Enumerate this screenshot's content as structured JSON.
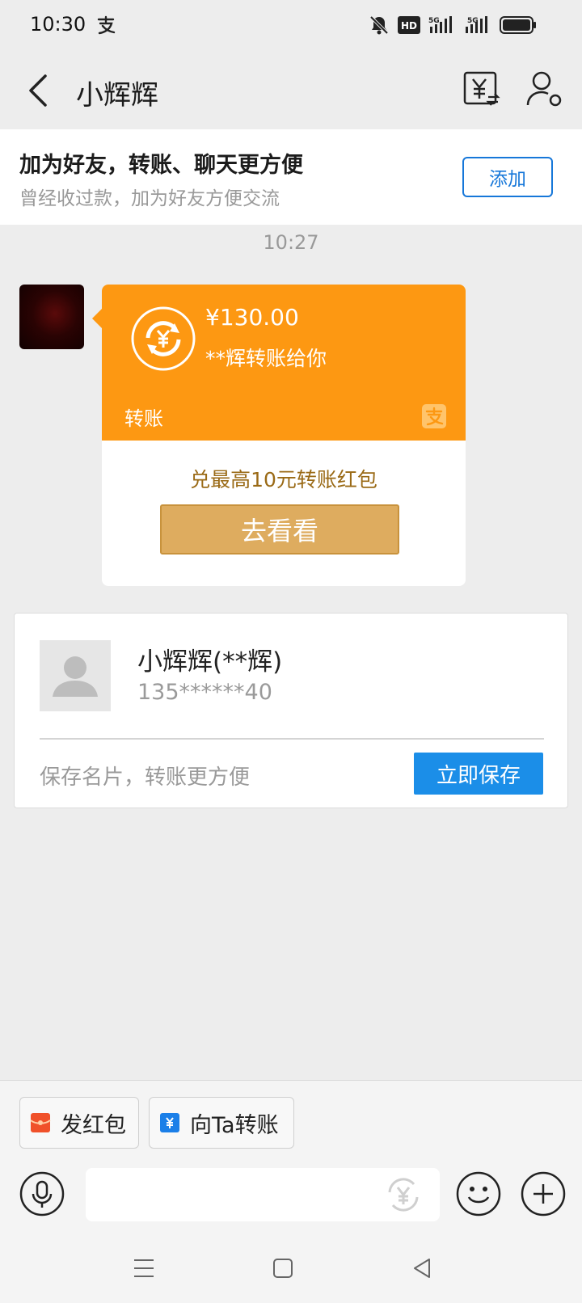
{
  "status_bar": {
    "time": "10:30",
    "icons": [
      "alipay-icon",
      "mute-icon",
      "hd-icon",
      "5g-signal-icon",
      "5g-signal-icon",
      "battery-icon"
    ],
    "hd_label": "HD",
    "network1": "5G",
    "network2": "5G"
  },
  "nav": {
    "title": "小辉辉"
  },
  "friend_banner": {
    "heading": "加为好友，转账、聊天更方便",
    "subtext": "曾经收过款，加为好友方便交流",
    "add_label": "添加"
  },
  "chat": {
    "timestamp": "10:27",
    "transfer_message": {
      "amount": "¥130.00",
      "description": "**辉转账给你",
      "type_label": "转账",
      "promo_text": "兑最高10元转账红包",
      "button_label": "去看看"
    }
  },
  "contact_card": {
    "name": "小辉辉(**辉)",
    "phone": "135******40",
    "hint": "保存名片，转账更方便",
    "save_label": "立即保存"
  },
  "quick_actions": {
    "red_packet_label": "发红包",
    "transfer_label": "向Ta转账"
  },
  "input": {
    "placeholder": ""
  },
  "colors": {
    "transfer_orange": "#fd9812",
    "link_blue": "#1677d9",
    "save_blue": "#1b8ee8",
    "promo_gold": "#deac5f"
  }
}
